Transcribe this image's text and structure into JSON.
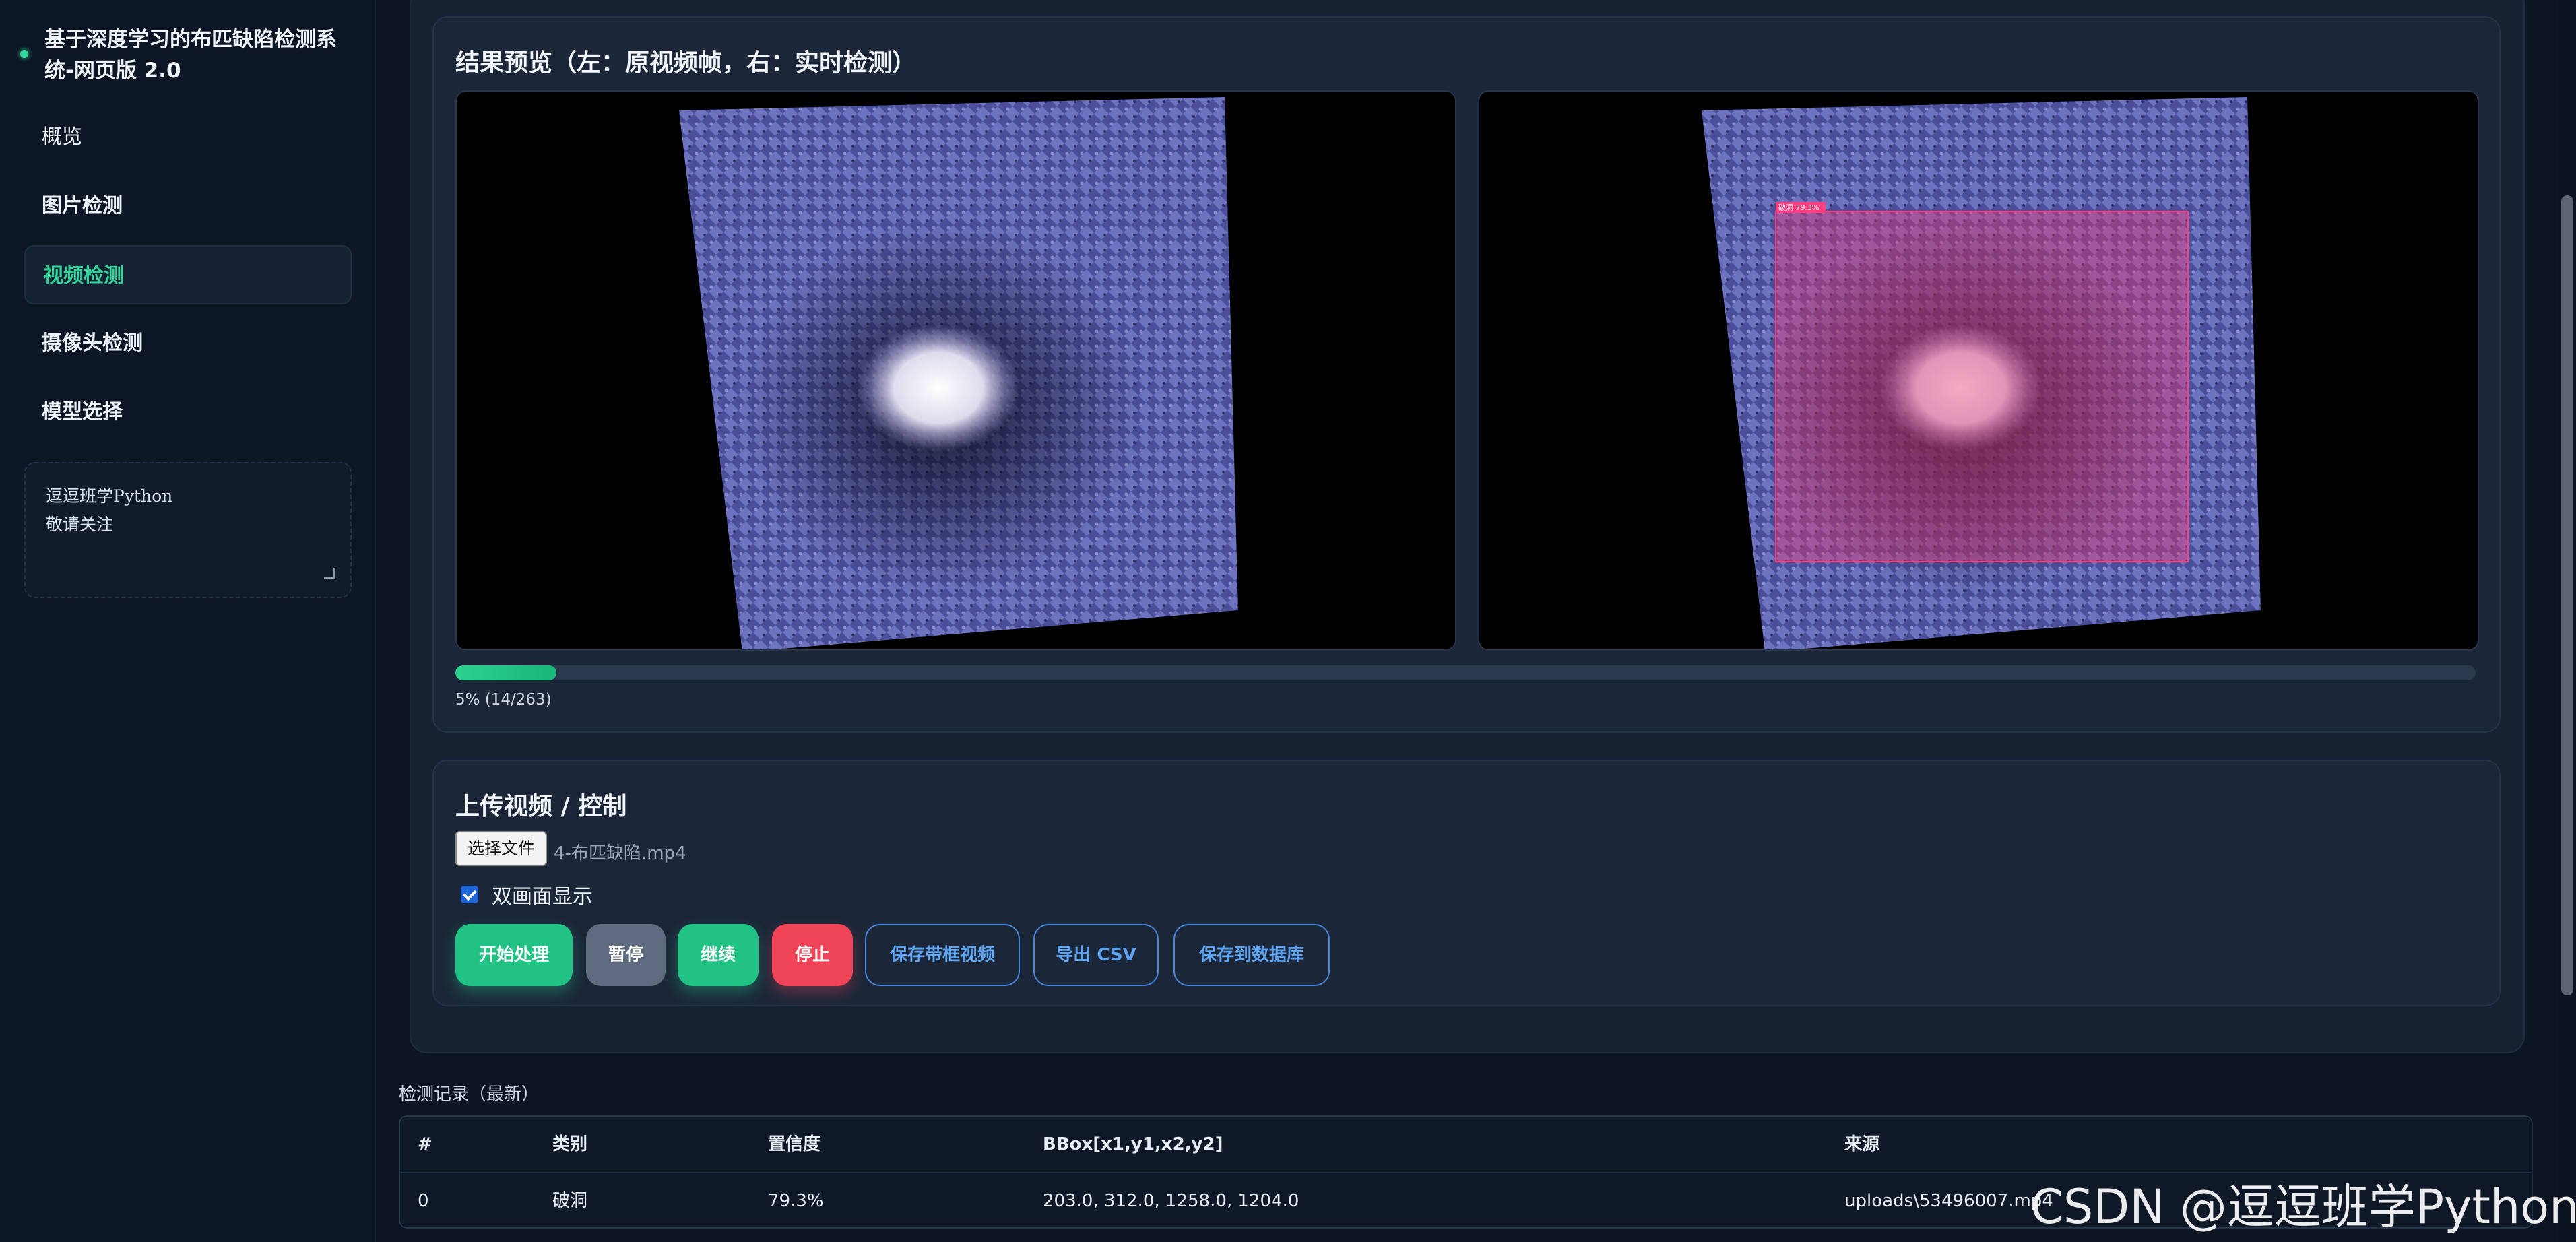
{
  "app": {
    "title": "基于深度学习的布匹缺陷检测系统-网页版 2.0"
  },
  "sidebar": {
    "items": [
      {
        "label": "概览",
        "active": false
      },
      {
        "label": "图片检测",
        "active": false
      },
      {
        "label": "视频检测",
        "active": true
      },
      {
        "label": "摄像头检测",
        "active": false
      },
      {
        "label": "模型选择",
        "active": false
      }
    ],
    "notes_text": "逗逗班学Python\n敬请关注"
  },
  "preview": {
    "title": "结果预览（左：原视频帧，右：实时检测）",
    "detection_label": "破洞 79.3%",
    "progress_percent": 5,
    "progress_text": "5% (14/263)"
  },
  "controls": {
    "title": "上传视频 / 控制",
    "file_button": "选择文件",
    "file_name": "4-布匹缺陷.mp4",
    "dual_view_label": "双画面显示",
    "dual_view_checked": true,
    "buttons": {
      "start": "开始处理",
      "pause": "暂停",
      "resume": "继续",
      "stop": "停止",
      "save_video": "保存带框视频",
      "export_csv": "导出 CSV",
      "save_db": "保存到数据库"
    }
  },
  "records": {
    "title": "检测记录（最新）",
    "columns": [
      "#",
      "类别",
      "置信度",
      "BBox[x1,y1,x2,y2]",
      "来源"
    ],
    "rows": [
      [
        "0",
        "破洞",
        "79.3%",
        "203.0, 312.0, 1258.0, 1204.0",
        "uploads\\53496007.mp4"
      ]
    ]
  },
  "watermark": "CSDN @逗逗班学Python",
  "colors": {
    "accent": "#34d399",
    "background": "#0d1522",
    "danger": "#ef4458",
    "link": "#5fa5f2"
  }
}
